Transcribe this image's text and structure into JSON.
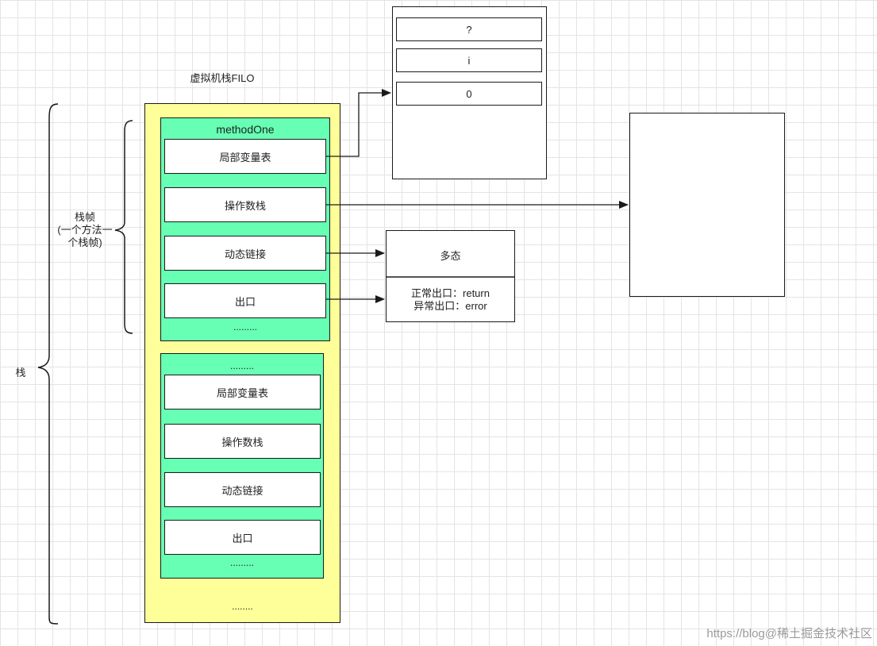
{
  "stack_title": "虚拟机栈FILO",
  "left_brace_label": "栈",
  "frame_brace_label": [
    "栈帧",
    "(一个方法一",
    "个栈帧)"
  ],
  "frame1": {
    "title": "methodOne",
    "items": [
      "局部变量表",
      "操作数栈",
      "动态链接",
      "出口"
    ],
    "ellipsis": "........."
  },
  "frame2": {
    "top_ellipsis": ".........",
    "items": [
      "局部变量表",
      "操作数栈",
      "动态链接",
      "出口"
    ],
    "ellipsis": "........."
  },
  "stack_bottom_ellipsis": "........",
  "local_vars_table": [
    "?",
    "i",
    "0"
  ],
  "dynamic_link_box": "多态",
  "exit_box": [
    "正常出口：return",
    "异常出口：error"
  ],
  "watermark": "https://blog@稀土掘金技术社区",
  "colors": {
    "stack_fill": "#ffff99",
    "frame_fill": "#66ffb3",
    "line": "#1a1a1a"
  }
}
